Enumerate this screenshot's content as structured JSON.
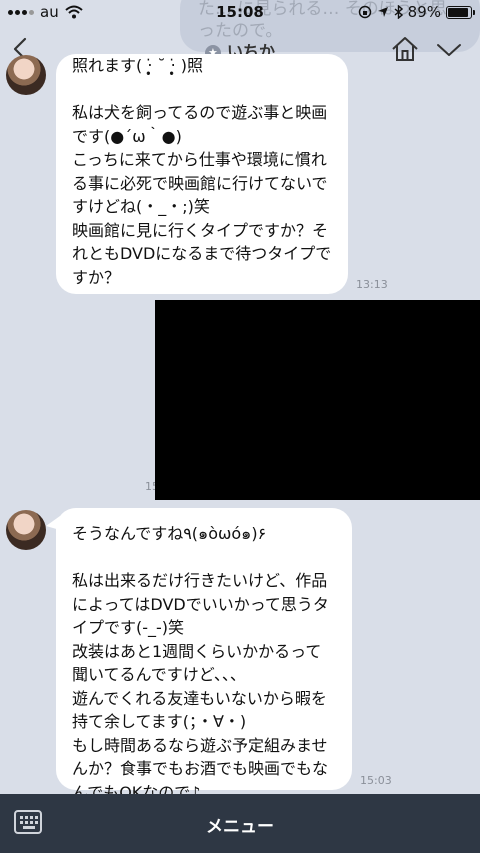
{
  "status_bar": {
    "carrier": "au",
    "time": "15:08",
    "battery": "89%"
  },
  "header": {
    "title": "いちか"
  },
  "faded_outgoing_text": "た… に見られる…\nそのほうと思ったので。",
  "messages": [
    {
      "text": "照れます( ‧̣̥̇ ˘ ‧̣̥̇ )照\n\n私は犬を飼ってるので遊ぶ事と映画です(●´ω｀●)\nこっちに来てから仕事や環境に慣れる事に必死で映画館に行けてないですけどね(・_・;)笑\n映画館に見に行くタイプですか？それともDVDになるまで待つタイプですか？",
      "time": "13:13"
    },
    {
      "text": "そうなんですね٩(๑òωó๑)۶\n\n私は出来るだけ行きたいけど、作品によってはDVDでいいかって思うタイプです(-_-)笑\n改装はあと1週間くらいかかるって聞いてるんですけど、、、\n遊んでくれる友達もいないから暇を持て余してます(；・∀・)\nもし時間あるなら遊ぶ予定組みませんか？食事でもお酒でも映画でもなんでもOKなので♪",
      "time": "15:03"
    }
  ],
  "media_time_partial": "15",
  "bottom_bar": {
    "menu_label": "メニュー"
  }
}
